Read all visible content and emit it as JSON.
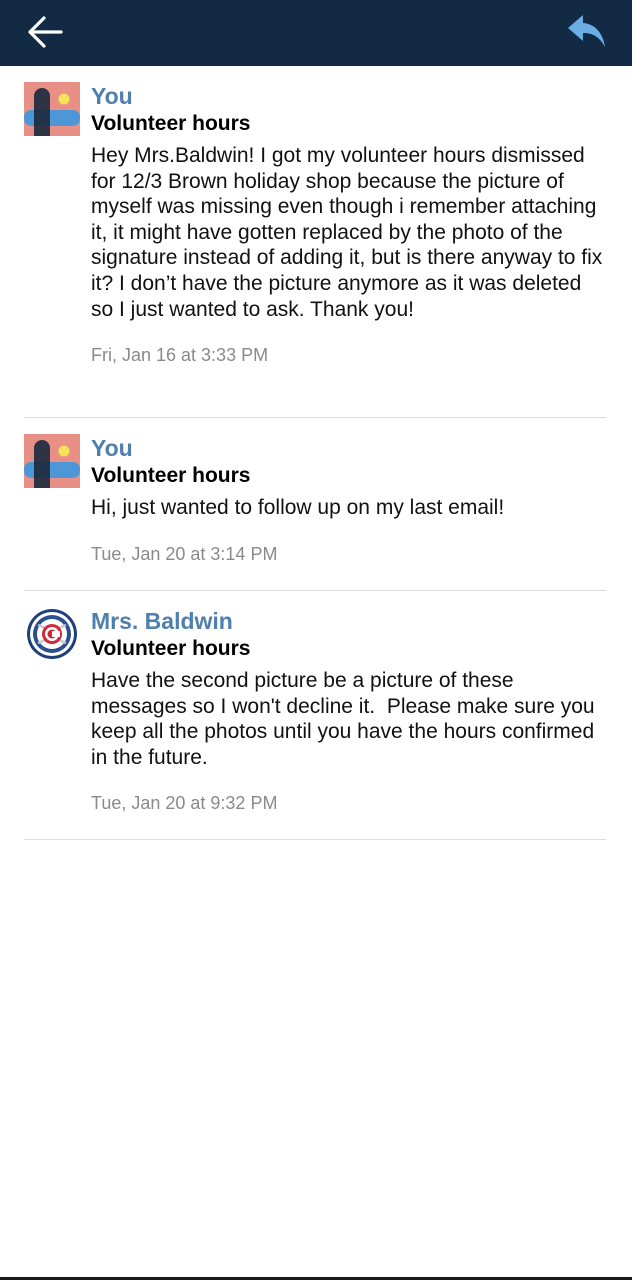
{
  "header": {
    "back_icon": "arrow-left-icon",
    "reply_icon": "reply-icon",
    "bar_color": "#132a45",
    "reply_color": "#6aaee4"
  },
  "messages": [
    {
      "sender": "You",
      "subject": "Volunteer hours",
      "body": "Hey Mrs.Baldwin! I got my volunteer hours dismissed for 12/3 Brown holiday shop because the picture of myself was missing even though i remember attaching it, it might have gotten replaced by the photo of the signature instead of adding it, but is there anyway to fix it? I don’t have the picture anymore as it was deleted so I just wanted to ask. Thank you!",
      "date": "Fri, Jan 16 at 3:33 PM",
      "avatar": "user-avatar"
    },
    {
      "sender": "You",
      "subject": "Volunteer hours",
      "body": "Hi, just wanted to follow up on my last email!",
      "date": "Tue, Jan 20 at 3:14 PM",
      "avatar": "user-avatar"
    },
    {
      "sender": "Mrs. Baldwin",
      "subject": "Volunteer hours",
      "body": "Have the second picture be a picture of these messages so I won't decline it.  Please make sure you keep all the photos until you have the hours confirmed in the future.",
      "date": "Tue, Jan 20 at 9:32 PM",
      "avatar": "cubs-logo-avatar"
    }
  ],
  "colors": {
    "sender_name": "#4f7fae",
    "date_text": "#8a8a8a",
    "divider": "#dcdcdc"
  }
}
